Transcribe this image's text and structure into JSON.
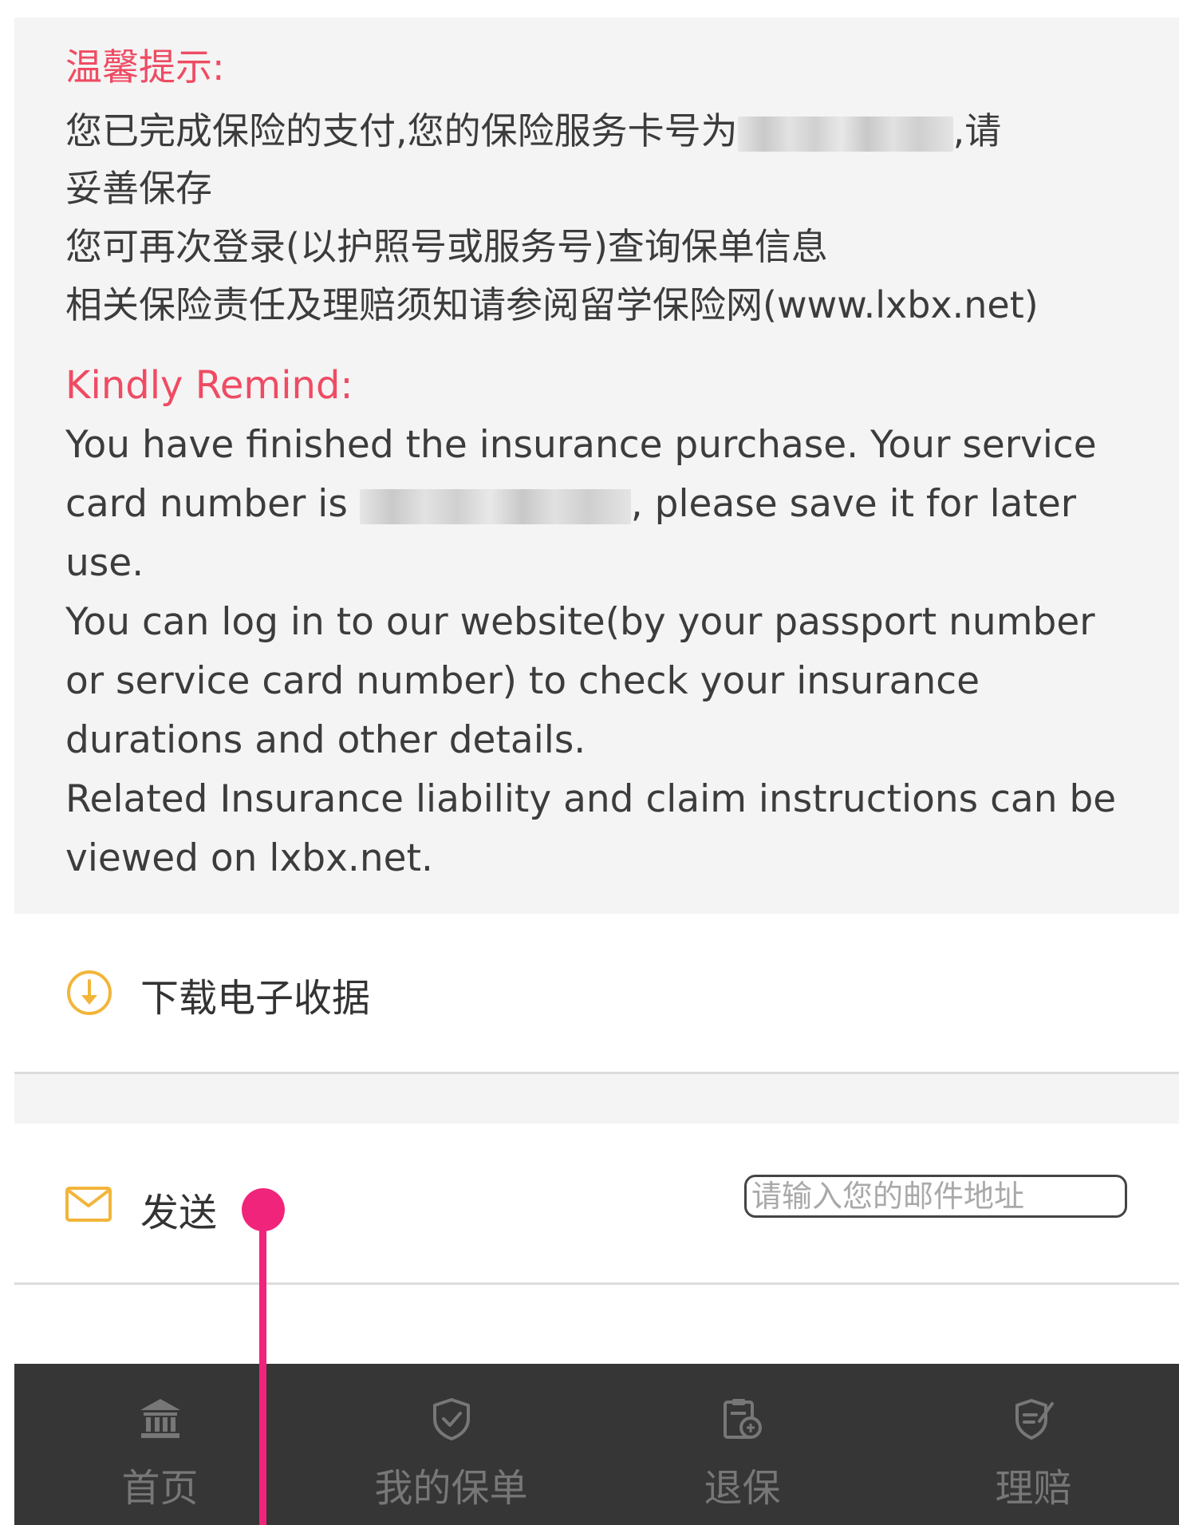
{
  "notice_zh": {
    "title": "温馨提示:",
    "line1_before": "您已完成保险的支付,您的保险服务卡号为",
    "line1_after": ",请",
    "line2": "妥善保存",
    "line3": "您可再次登录(以护照号或服务号)查询保单信息",
    "line4": "相关保险责任及理赔须知请参阅留学保险网(www.lxbx.net)"
  },
  "notice_en": {
    "title": "Kindly Remind:",
    "line1": "You have finished the insurance purchase. Your service",
    "line2_before": "card number is ",
    "line2_after": ", please save it for later",
    "line3": "use.",
    "line4": "You can log in to our website(by your passport number",
    "line5": "or service card number) to check your insurance",
    "line6": "durations and other details.",
    "line7": "Related Insurance liability and claim instructions can be",
    "line8": "viewed on lxbx.net."
  },
  "actions": {
    "download_label": "下载电子收据",
    "send_label": "发送",
    "email_placeholder": "请输入您的邮件地址",
    "email_value": ""
  },
  "tabbar": {
    "tabs": [
      {
        "label": "首页",
        "icon": "bank-icon"
      },
      {
        "label": "我的保单",
        "icon": "shield-check-icon"
      },
      {
        "label": "退保",
        "icon": "document-refund-icon"
      },
      {
        "label": "理赔",
        "icon": "claim-shield-icon"
      }
    ]
  },
  "colors": {
    "accent_red": "#ef4b63",
    "icon_orange": "#f2b53a",
    "tabbar_bg": "#363636",
    "marker_pink": "#f0247a"
  }
}
